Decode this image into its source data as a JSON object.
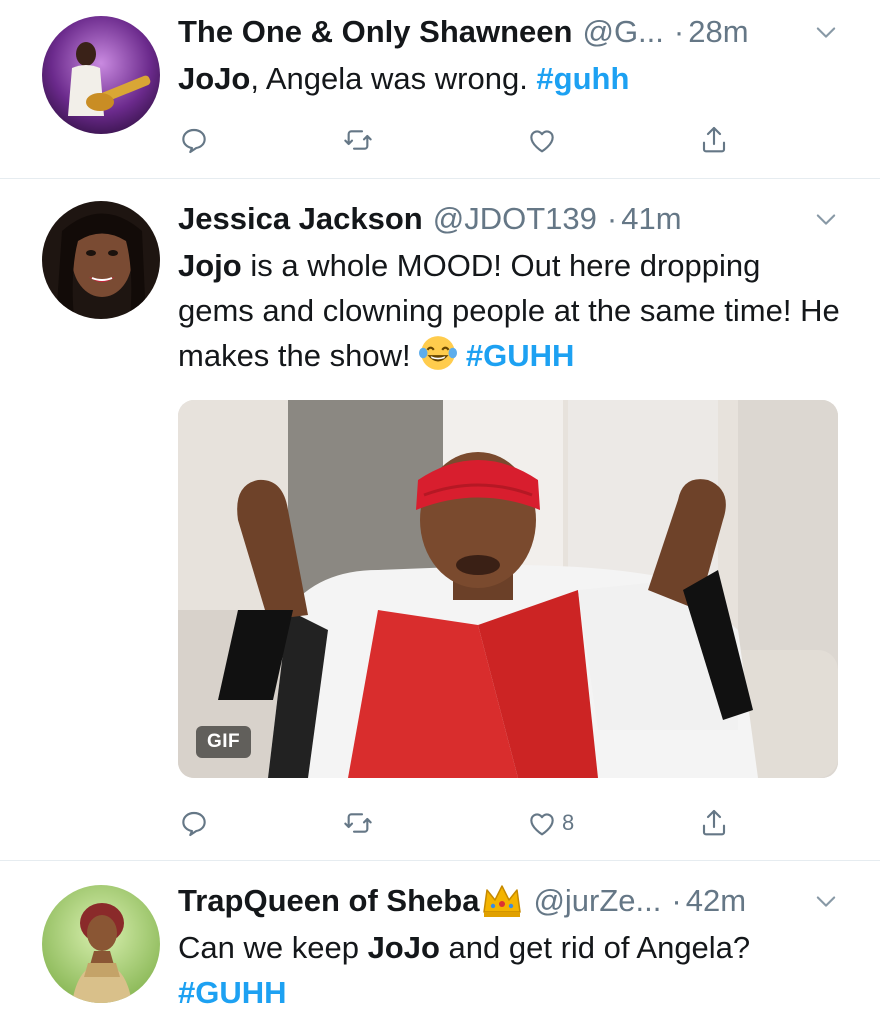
{
  "tweets": [
    {
      "name": "The One & Only Shawneen",
      "handle": "@G...",
      "dot": "·",
      "time": "28m",
      "text": {
        "b1": "JoJo",
        "t1": ", Angela was wrong. ",
        "tag": "#guhh"
      },
      "actions": {
        "reply": "",
        "retweet": "",
        "like": "",
        "share": ""
      }
    },
    {
      "name": "Jessica Jackson",
      "handle": "@JDOT139",
      "dot": "·",
      "time": "41m",
      "text": {
        "b1": "Jojo",
        "t1": " is a whole MOOD! Out here dropping gems and clowning people at the same time! He makes the show! ",
        "emoji": "face-with-tears-of-joy",
        "tag": "#GUHH"
      },
      "media": {
        "badge": "GIF"
      },
      "actions": {
        "like_count": "8"
      }
    },
    {
      "name": "TrapQueen of Sheba",
      "name_emoji": "crown",
      "handle": "@jurZe...",
      "dot": "·",
      "time": "42m",
      "text": {
        "t0": "Can we keep ",
        "b1": "JoJo",
        "t1": " and get rid of Angela?",
        "tag": "#GUHH"
      }
    }
  ],
  "colors": {
    "accent": "#1da1f2",
    "muted": "#657786",
    "text": "#14171a",
    "divider": "#e6ecf0"
  },
  "icons": [
    "reply-icon",
    "retweet-icon",
    "like-icon",
    "share-icon",
    "chevron-down-icon"
  ]
}
